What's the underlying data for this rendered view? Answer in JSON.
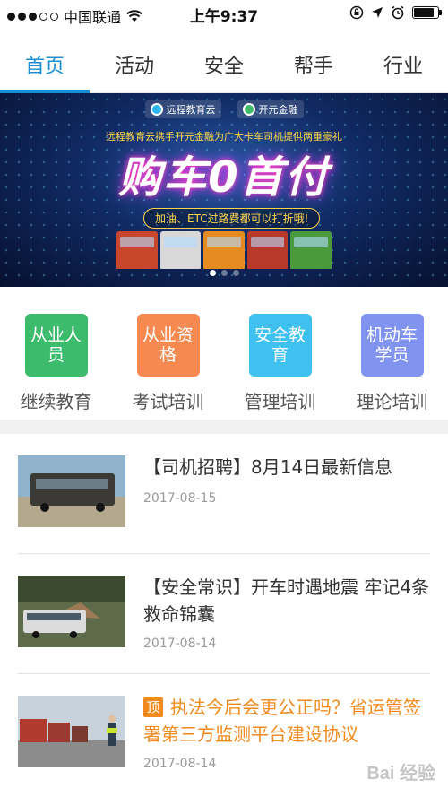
{
  "status_bar": {
    "carrier": "中国联通",
    "time": "上午9:37"
  },
  "tabs": [
    {
      "label": "首页",
      "active": true
    },
    {
      "label": "活动",
      "active": false
    },
    {
      "label": "安全",
      "active": false
    },
    {
      "label": "帮手",
      "active": false
    },
    {
      "label": "行业",
      "active": false
    }
  ],
  "banner": {
    "logo1": "远程教育云",
    "logo2": "开元金融",
    "tagline": "远程教育云携手开元金融为广大卡车司机提供两重豪礼",
    "headline": "购车0首付",
    "pill": "加油、ETC过路费都可以打折哦!"
  },
  "categories": [
    {
      "icon_text": "从业人员",
      "label": "继续教育",
      "color": "#3dbb6c"
    },
    {
      "icon_text": "从业资格",
      "label": "考试培训",
      "color": "#f5894f"
    },
    {
      "icon_text": "安全教育",
      "label": "管理培训",
      "color": "#3fc1f0"
    },
    {
      "icon_text": "机动车学员",
      "label": "理论培训",
      "color": "#7f93ef"
    }
  ],
  "news": [
    {
      "title": "【司机招聘】8月14日最新信息",
      "date": "2017-08-15",
      "top": false
    },
    {
      "title": "【安全常识】开车时遇地震 牢记4条救命锦囊",
      "date": "2017-08-14",
      "top": false
    },
    {
      "title": "执法今后会更公正吗？省运管签署第三方监测平台建设协议",
      "date": "2017-08-14",
      "top": true,
      "badge": "顶"
    }
  ],
  "watermark": "Bai 经验",
  "colors": {
    "accent": "#1a8fd6",
    "top_news": "#f08a1c"
  }
}
